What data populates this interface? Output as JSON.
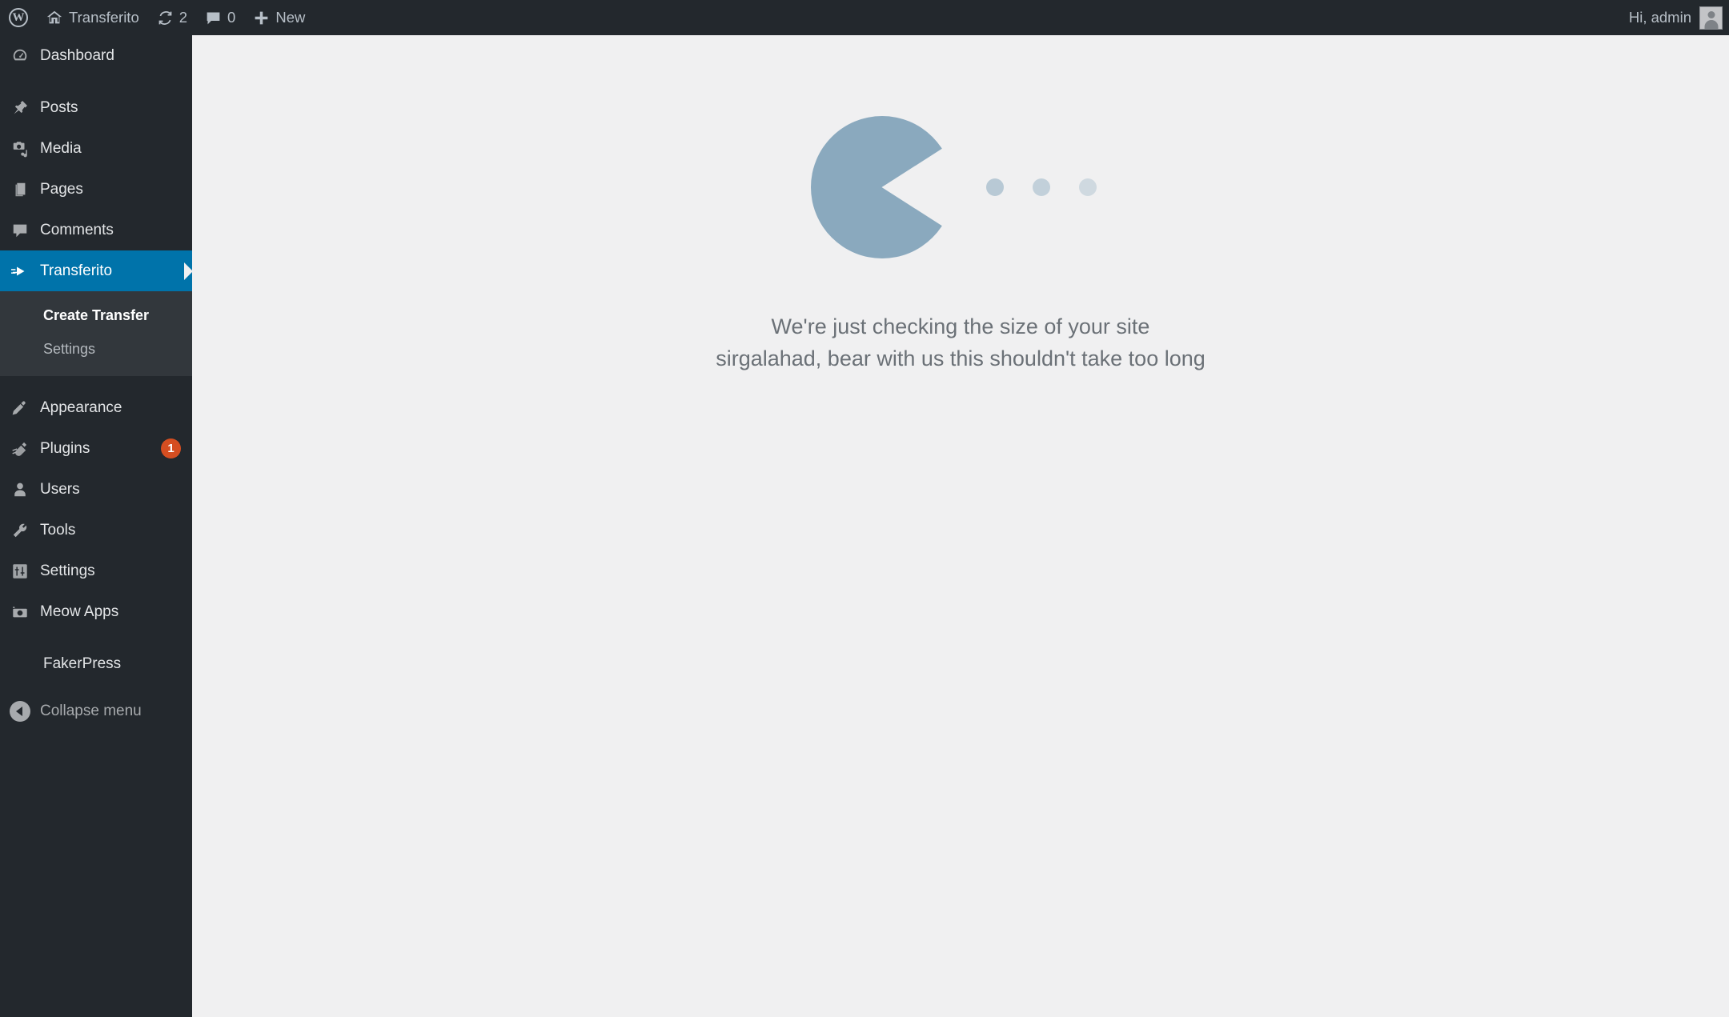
{
  "adminbar": {
    "wp_logo": {
      "icon": "wordpress-logo-icon",
      "label": "W"
    },
    "site_name": {
      "icon": "home-icon",
      "label": "Transferito"
    },
    "updates": {
      "icon": "update-icon",
      "count": "2"
    },
    "comments": {
      "icon": "comment-bubble-icon",
      "count": "0"
    },
    "new": {
      "icon": "plus-icon",
      "label": "New"
    },
    "account": {
      "greeting": "Hi, admin",
      "avatar_icon": "user-avatar-icon"
    }
  },
  "sidebar": {
    "items": [
      {
        "label": "Dashboard",
        "icon": "dashboard-icon",
        "current": false,
        "badge": null
      },
      {
        "label": "Posts",
        "icon": "pin-icon",
        "current": false,
        "badge": null
      },
      {
        "label": "Media",
        "icon": "media-camera-icon",
        "current": false,
        "badge": null
      },
      {
        "label": "Pages",
        "icon": "pages-icon",
        "current": false,
        "badge": null
      },
      {
        "label": "Comments",
        "icon": "comment-bubble-icon",
        "current": false,
        "badge": null
      },
      {
        "label": "Transferito",
        "icon": "transfer-arrow-icon",
        "current": true,
        "badge": null
      },
      {
        "label": "Appearance",
        "icon": "paintbrush-icon",
        "current": false,
        "badge": null
      },
      {
        "label": "Plugins",
        "icon": "plug-icon",
        "current": false,
        "badge": "1"
      },
      {
        "label": "Users",
        "icon": "user-icon",
        "current": false,
        "badge": null
      },
      {
        "label": "Tools",
        "icon": "wrench-icon",
        "current": false,
        "badge": null
      },
      {
        "label": "Settings",
        "icon": "sliders-icon",
        "current": false,
        "badge": null
      },
      {
        "label": "Meow Apps",
        "icon": "camera-icon",
        "current": false,
        "badge": null
      },
      {
        "label": "FakerPress",
        "icon": null,
        "current": false,
        "badge": null
      }
    ],
    "submenu": {
      "parent": "Transferito",
      "items": [
        {
          "label": "Create Transfer",
          "current": true
        },
        {
          "label": "Settings",
          "current": false
        }
      ]
    },
    "collapse": {
      "label": "Collapse menu",
      "icon": "collapse-arrow-icon"
    }
  },
  "main": {
    "loader": {
      "graphic": "pacman-loading-icon",
      "dot_count": "3",
      "message_line1": "We're just checking the size of your site",
      "message_line2": "sirgalahad, bear with us this shouldn't take too long"
    }
  },
  "colors": {
    "admin_bar_bg": "#23282d",
    "sidebar_bg": "#23282d",
    "submenu_bg": "#32373c",
    "current_highlight": "#0073aa",
    "content_bg": "#f0f0f1",
    "pacman": "#8aa9be",
    "badge_orange": "#d54e21",
    "message_text": "#6b7177"
  }
}
